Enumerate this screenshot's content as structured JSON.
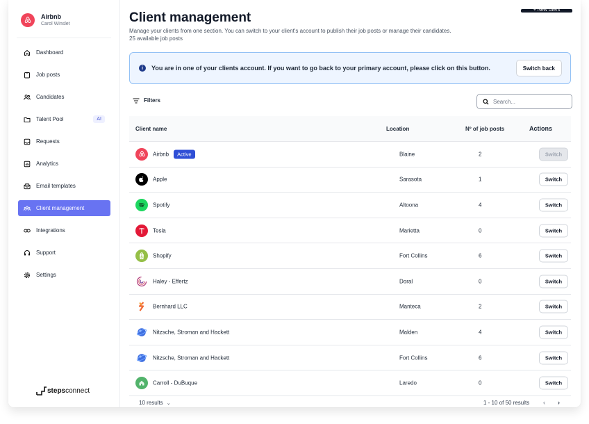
{
  "sidebar": {
    "brand_name": "Airbnb",
    "brand_user": "Carol Winslet",
    "items": [
      {
        "label": "Dashboard",
        "icon": "home-icon"
      },
      {
        "label": "Job posts",
        "icon": "clipboard-icon"
      },
      {
        "label": "Candidates",
        "icon": "users-icon"
      },
      {
        "label": "Talent Pool",
        "icon": "folder-icon",
        "badge": "AI"
      },
      {
        "label": "Requests",
        "icon": "inbox-icon"
      },
      {
        "label": "Analytics",
        "icon": "chart-icon"
      },
      {
        "label": "Email templates",
        "icon": "mail-icon"
      },
      {
        "label": "Client management",
        "icon": "team-icon",
        "active": true
      },
      {
        "label": "Integrations",
        "icon": "link-icon"
      },
      {
        "label": "Support",
        "icon": "headset-icon"
      },
      {
        "label": "Settings",
        "icon": "gear-icon"
      }
    ],
    "footer_logo": {
      "bold": "steps",
      "regular": "connect"
    }
  },
  "header": {
    "title": "Client management",
    "subtitle": "Manage your clients from one section. You can switch to your client's account to publish their job posts or manage their candidates.",
    "job_count": "25 available job posts",
    "new_client_label": "+ New client"
  },
  "banner": {
    "text": "You are in one of your clients account. If you want to go back to your primary account, please click on this button.",
    "button_label": "Switch back"
  },
  "toolbar": {
    "filters_label": "Filters",
    "search_placeholder": "Search..."
  },
  "table": {
    "columns": [
      "Client name",
      "Location",
      "Nº of job posts",
      "Actions"
    ],
    "active_label": "Active",
    "switch_label": "Switch",
    "rows": [
      {
        "name": "Airbnb",
        "location": "Blaine",
        "jobs": "2",
        "active": true,
        "logo_color": "#f0445a",
        "logo": "airbnb-logo-icon"
      },
      {
        "name": "Apple",
        "location": "Sarasota",
        "jobs": "1",
        "logo_color": "#000000",
        "logo": "apple-logo-icon"
      },
      {
        "name": "Spotify",
        "location": "Altoona",
        "jobs": "4",
        "logo_color": "#1ed760",
        "logo": "spotify-logo-icon"
      },
      {
        "name": "Tesla",
        "location": "Marietta",
        "jobs": "0",
        "logo_color": "#e31937",
        "logo": "tesla-logo-icon"
      },
      {
        "name": "Shopify",
        "location": "Fort Collins",
        "jobs": "6",
        "logo_color": "#95bf47",
        "logo": "shopify-logo-icon"
      },
      {
        "name": "Haley - Effertz",
        "location": "Doral",
        "jobs": "0",
        "logo_color": "#ffffff",
        "logo": "spiral-logo-icon"
      },
      {
        "name": "Bernhard LLC",
        "location": "Manteca",
        "jobs": "2",
        "logo_color": "#ffffff",
        "logo": "bernhard-logo-icon"
      },
      {
        "name": "Nitzsche, Stroman and Hackett",
        "location": "Malden",
        "jobs": "4",
        "logo_color": "#ffffff",
        "logo": "globe-logo-icon"
      },
      {
        "name": "Nitzsche, Stroman and Hackett",
        "location": "Fort Collins",
        "jobs": "6",
        "logo_color": "#ffffff",
        "logo": "globe-logo-icon"
      },
      {
        "name": "Carroll - DuBuque",
        "location": "Laredo",
        "jobs": "0",
        "logo_color": "#52b36b",
        "logo": "house-logo-icon"
      }
    ]
  },
  "pagination": {
    "page_size_label": "10 results",
    "range_label": "1 - 10 of 50 results",
    "prev": "‹",
    "next": "›"
  },
  "colors": {
    "accent": "#6873f2",
    "banner_bg": "#eef5ff",
    "banner_border": "#93c1f5",
    "active_badge": "#2f4fd6"
  }
}
